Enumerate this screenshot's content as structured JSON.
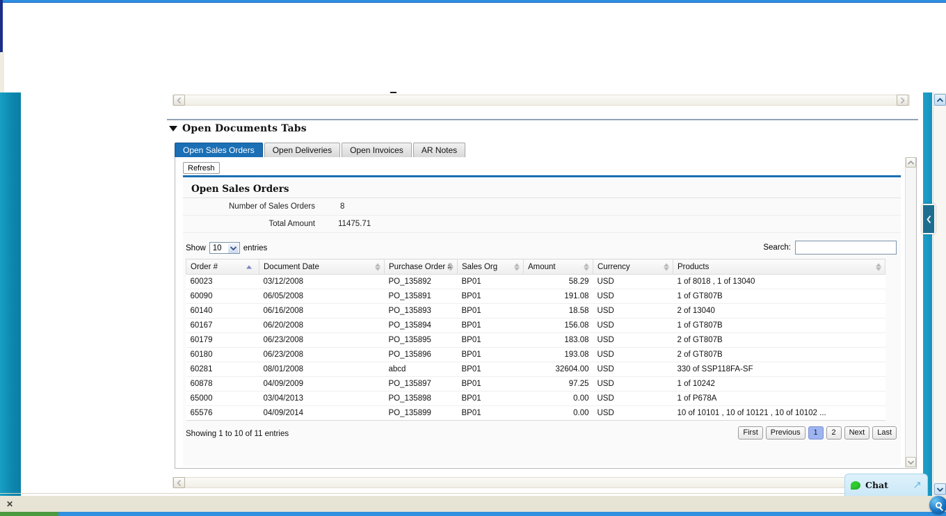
{
  "section": {
    "title": "Open Documents Tabs",
    "collapse_icon": "triangle-down-icon"
  },
  "tabs": [
    {
      "label": "Open Sales Orders",
      "active": true
    },
    {
      "label": "Open Deliveries",
      "active": false
    },
    {
      "label": "Open Invoices",
      "active": false
    },
    {
      "label": "AR Notes",
      "active": false
    }
  ],
  "toolbar": {
    "refresh_label": "Refresh"
  },
  "panel": {
    "heading": "Open Sales Orders",
    "summary": [
      {
        "label": "Number of Sales Orders",
        "value": "8"
      },
      {
        "label": "Total Amount",
        "value": "11475.71"
      }
    ]
  },
  "controls": {
    "show_prefix": "Show",
    "page_length": "10",
    "show_suffix": "entries",
    "search_label": "Search:",
    "search_value": "",
    "search_placeholder": ""
  },
  "table": {
    "columns": [
      {
        "label": "Order #",
        "sorted": true,
        "align": "left"
      },
      {
        "label": "Document Date",
        "sorted": false,
        "align": "left"
      },
      {
        "label": "Purchase Order #",
        "sorted": false,
        "align": "left"
      },
      {
        "label": "Sales Org",
        "sorted": false,
        "align": "left"
      },
      {
        "label": "Amount",
        "sorted": false,
        "align": "right"
      },
      {
        "label": "Currency",
        "sorted": false,
        "align": "left"
      },
      {
        "label": "Products",
        "sorted": false,
        "align": "left"
      }
    ],
    "rows": [
      [
        "60023",
        "03/12/2008",
        "PO_135892",
        "BP01",
        "58.29",
        "USD",
        "1 of 8018 , 1 of 13040"
      ],
      [
        "60090",
        "06/05/2008",
        "PO_135891",
        "BP01",
        "191.08",
        "USD",
        "1 of GT807B"
      ],
      [
        "60140",
        "06/16/2008",
        "PO_135893",
        "BP01",
        "18.58",
        "USD",
        "2 of 13040"
      ],
      [
        "60167",
        "06/20/2008",
        "PO_135894",
        "BP01",
        "156.08",
        "USD",
        "1 of GT807B"
      ],
      [
        "60179",
        "06/23/2008",
        "PO_135895",
        "BP01",
        "183.08",
        "USD",
        "2 of GT807B"
      ],
      [
        "60180",
        "06/23/2008",
        "PO_135896",
        "BP01",
        "193.08",
        "USD",
        "2 of GT807B"
      ],
      [
        "60281",
        "08/01/2008",
        "abcd",
        "BP01",
        "32604.00",
        "USD",
        "330 of SSP118FA-SF"
      ],
      [
        "60878",
        "04/09/2009",
        "PO_135897",
        "BP01",
        "97.25",
        "USD",
        "1 of 10242"
      ],
      [
        "65000",
        "03/04/2013",
        "PO_135898",
        "BP01",
        "0.00",
        "USD",
        "1 of P678A"
      ],
      [
        "65576",
        "04/09/2014",
        "PO_135899",
        "BP01",
        "0.00",
        "USD",
        "10 of 10101 , 10 of 10121 , 10 of 10102 ..."
      ]
    ]
  },
  "footer": {
    "info": "Showing 1 to 10 of 11 entries",
    "pagination": [
      {
        "label": "First",
        "active": false
      },
      {
        "label": "Previous",
        "active": false
      },
      {
        "label": "1",
        "active": true
      },
      {
        "label": "2",
        "active": false
      },
      {
        "label": "Next",
        "active": false
      },
      {
        "label": "Last",
        "active": false
      }
    ]
  },
  "chat": {
    "label": "Chat",
    "bubble_icon": "chat-bubble-icon",
    "expand_icon": "arrow-up-right-icon"
  },
  "taskbar": {
    "close_label": "✕"
  },
  "colors": {
    "accent_blue": "#1a6fb5",
    "tab_active": "#1a6fb5",
    "pager_active": "#9db4f0",
    "teal_rail": "#0e8ab0",
    "chat_bubble_green": "#2ecc2e"
  }
}
